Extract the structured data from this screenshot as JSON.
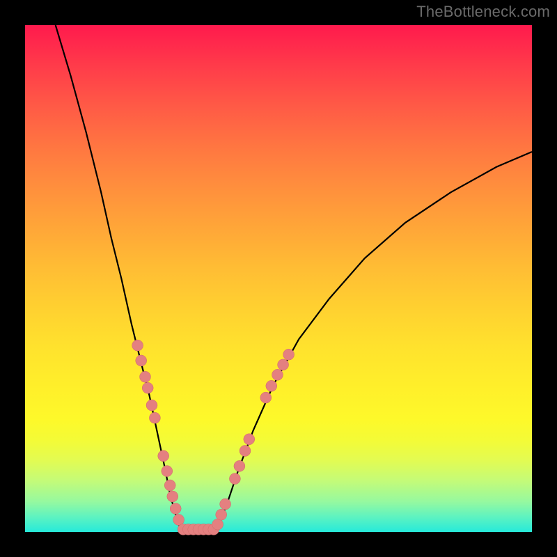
{
  "watermark": "TheBottleneck.com",
  "chart_data": {
    "type": "line",
    "title": "",
    "xlabel": "",
    "ylabel": "",
    "xlim": [
      0,
      100
    ],
    "ylim": [
      0,
      100
    ],
    "grid": false,
    "legend": false,
    "background": {
      "gradient_direction": "top-to-bottom",
      "colors_top_to_bottom": [
        "#ff1a4d",
        "#ff5a46",
        "#ff8f3d",
        "#ffbd34",
        "#ffe32d",
        "#fdf92a",
        "#e2fb53",
        "#96f99f",
        "#26eada"
      ]
    },
    "series": [
      {
        "name": "bottleneck-curve-left",
        "x": [
          6,
          9,
          12,
          15,
          17,
          19,
          21,
          23,
          24.5,
          26,
          27.5,
          28.5,
          29.5,
          30.5,
          31.5
        ],
        "y": [
          100,
          90,
          79,
          67,
          58,
          50,
          41,
          33,
          27,
          20,
          13,
          8,
          4,
          1,
          0
        ]
      },
      {
        "name": "bottleneck-curve-floor",
        "x": [
          31.5,
          33,
          34.5,
          36,
          37.5
        ],
        "y": [
          0,
          0,
          0,
          0,
          0
        ]
      },
      {
        "name": "bottleneck-curve-right",
        "x": [
          37.5,
          38.5,
          40,
          42,
          45,
          49,
          54,
          60,
          67,
          75,
          84,
          93,
          100
        ],
        "y": [
          0,
          2,
          6,
          12,
          20,
          29,
          38,
          46,
          54,
          61,
          67,
          72,
          75
        ]
      }
    ],
    "markers": [
      {
        "name": "beads-left-upper",
        "x": [
          22.2,
          22.9,
          23.7,
          24.2,
          25.0,
          25.6
        ],
        "y": [
          36.8,
          33.8,
          30.6,
          28.4,
          25.0,
          22.5
        ]
      },
      {
        "name": "beads-left-lower",
        "x": [
          27.3,
          28.0,
          28.6,
          29.1,
          29.7,
          30.3
        ],
        "y": [
          15.0,
          12.0,
          9.2,
          7.0,
          4.6,
          2.4
        ]
      },
      {
        "name": "beads-floor",
        "x": [
          31.2,
          32.2,
          33.2,
          34.2,
          35.2,
          36.2,
          37.2
        ],
        "y": [
          0.5,
          0.5,
          0.5,
          0.5,
          0.5,
          0.5,
          0.5
        ]
      },
      {
        "name": "beads-right-lower",
        "x": [
          38.0,
          38.7,
          39.5
        ],
        "y": [
          1.5,
          3.4,
          5.5
        ]
      },
      {
        "name": "beads-right-mid",
        "x": [
          41.4,
          42.3,
          43.4,
          44.2
        ],
        "y": [
          10.5,
          13.0,
          16.0,
          18.3
        ]
      },
      {
        "name": "beads-right-upper",
        "x": [
          47.5,
          48.6,
          49.8,
          50.9,
          52.0
        ],
        "y": [
          26.5,
          28.8,
          31.0,
          33.0,
          35.0
        ]
      }
    ],
    "marker_style": {
      "color": "#e48080",
      "radius_px": 8,
      "shape": "circle"
    }
  }
}
